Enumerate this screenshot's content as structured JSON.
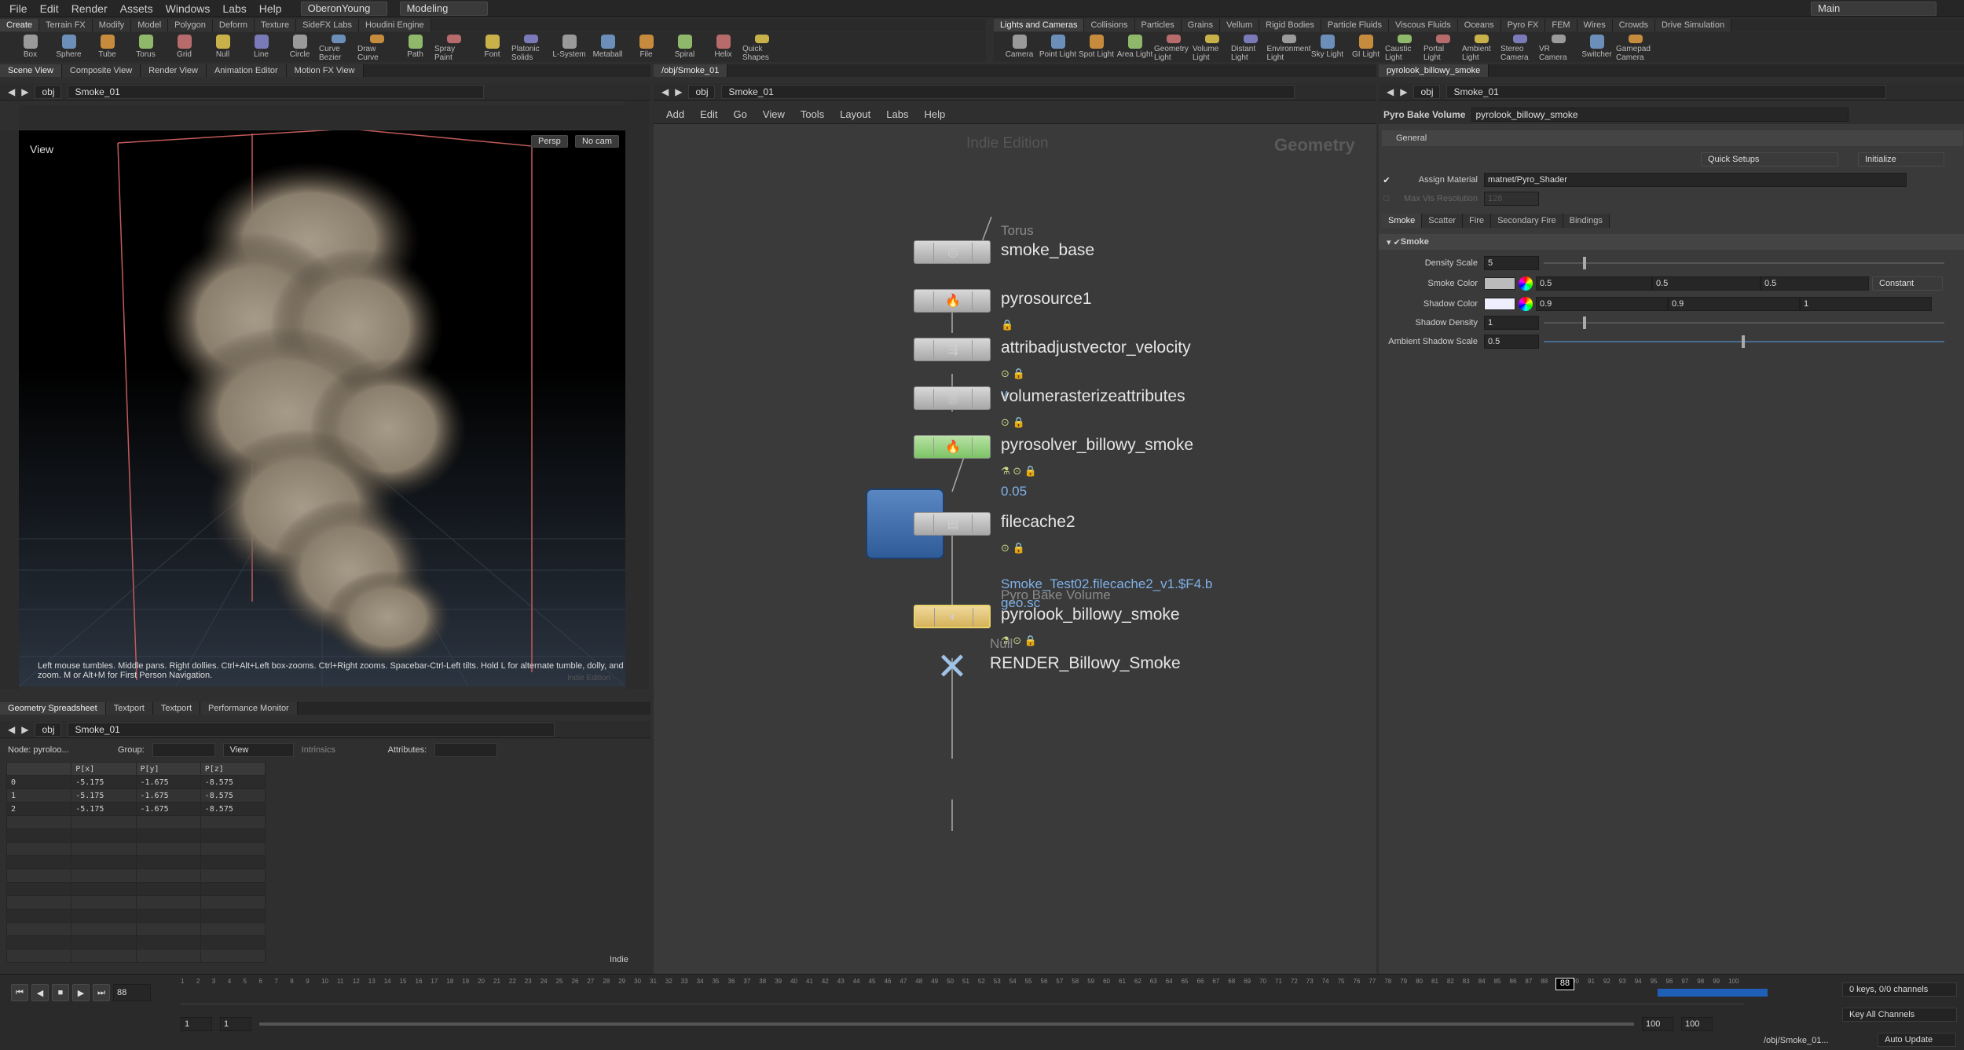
{
  "menubar": {
    "items": [
      "File",
      "Edit",
      "Render",
      "Assets",
      "Windows",
      "Labs",
      "Help"
    ],
    "user": "OberonYoung",
    "desktop": "Modeling",
    "main": "Main"
  },
  "shelf_left": {
    "tabs": [
      "Create",
      "Terrain FX",
      "Modify",
      "Model",
      "Polygon",
      "Deform",
      "Texture",
      "SideFX Labs",
      "Houdini Engine"
    ],
    "tools": [
      "Box",
      "Sphere",
      "Tube",
      "Torus",
      "Grid",
      "Null",
      "Line",
      "Circle",
      "Curve Bezier",
      "Draw Curve",
      "Path",
      "Spray Paint",
      "Font",
      "Platonic Solids",
      "L-System",
      "Metaball",
      "File",
      "Spiral",
      "Helix",
      "Quick Shapes"
    ]
  },
  "shelf_right": {
    "tabs": [
      "Lights and Cameras",
      "Collisions",
      "Particles",
      "Grains",
      "Vellum",
      "Rigid Bodies",
      "Particle Fluids",
      "Viscous Fluids",
      "Oceans",
      "Pyro FX",
      "FEM",
      "Wires",
      "Crowds",
      "Drive Simulation"
    ],
    "tools": [
      "Camera",
      "Point Light",
      "Spot Light",
      "Area Light",
      "Geometry Light",
      "Volume Light",
      "Distant Light",
      "Environment Light",
      "Sky Light",
      "GI Light",
      "Caustic Light",
      "Portal Light",
      "Ambient Light",
      "Stereo Camera",
      "VR Camera",
      "Switcher",
      "Gamepad Camera"
    ]
  },
  "viewer": {
    "tabs": [
      "Scene View",
      "Composite View",
      "Render View",
      "Animation Editor",
      "Motion FX View"
    ],
    "path_root": "obj",
    "path_node": "Smoke_01",
    "view_label": "View",
    "persp": "Persp",
    "cam": "No cam",
    "hint": "Left mouse tumbles. Middle pans. Right dollies. Ctrl+Alt+Left box-zooms. Ctrl+Right zooms. Spacebar-Ctrl-Left tilts. Hold L for alternate tumble, dolly, and zoom. M or Alt+M for First Person Navigation.",
    "watermark": "Indie Edition"
  },
  "network": {
    "tab": "/obj/Smoke_01",
    "path_root": "obj",
    "path_node": "Smoke_01",
    "menu": [
      "Add",
      "Edit",
      "Go",
      "View",
      "Tools",
      "Layout",
      "Labs",
      "Help"
    ],
    "edition": "Indie Edition",
    "context": "Geometry",
    "nodes": [
      {
        "type": "Torus",
        "name": "smoke_base"
      },
      {
        "name": "pyrosource1"
      },
      {
        "name": "attribadjustvector_velocity",
        "sub": "v"
      },
      {
        "name": "volumerasterizeattributes"
      },
      {
        "name": "pyrosolver_billowy_smoke",
        "sub": "0.05"
      },
      {
        "name": "filecache2",
        "sub": "Smoke_Test02.filecache2_v1.$F4.b",
        "sub2": "geo.sc"
      },
      {
        "type": "Pyro Bake Volume",
        "name": "pyrolook_billowy_smoke"
      },
      {
        "type": "Null",
        "name": "RENDER_Billowy_Smoke"
      }
    ]
  },
  "params": {
    "tab": "pyrolook_billowy_smoke",
    "path_root": "obj",
    "path_node": "Smoke_01",
    "node_type": "Pyro Bake Volume",
    "node_name": "pyrolook_billowy_smoke",
    "general": "General",
    "quick_setups": "Quick Setups",
    "initialize": "Initialize",
    "assign_material_label": "Assign Material",
    "assign_material": "matnet/Pyro_Shader",
    "max_vis_label": "Max Vis Resolution",
    "max_vis": "128",
    "tabs": [
      "Smoke",
      "Scatter",
      "Fire",
      "Secondary Fire",
      "Bindings"
    ],
    "section": "Smoke",
    "density_scale_label": "Density Scale",
    "density_scale": "5",
    "smoke_color_label": "Smoke Color",
    "smoke_color": [
      "0.5",
      "0.5",
      "0.5"
    ],
    "smoke_color_mode": "Constant",
    "shadow_color_label": "Shadow Color",
    "shadow_color": [
      "0.9",
      "0.9",
      "1"
    ],
    "shadow_density_label": "Shadow Density",
    "shadow_density": "1",
    "ambient_shadow_label": "Ambient Shadow Scale",
    "ambient_shadow": "0.5"
  },
  "spreadsheet": {
    "tabs": [
      "Geometry Spreadsheet",
      "Textport",
      "Textport",
      "Performance Monitor"
    ],
    "path_root": "obj",
    "path_node": "Smoke_01",
    "node": "Node: pyroloo...",
    "group_label": "Group:",
    "view": "View",
    "intrinsics": "Intrinsics",
    "attributes": "Attributes:",
    "columns": [
      "",
      "P[x]",
      "P[y]",
      "P[z]"
    ],
    "rows": [
      [
        "0",
        "-5.175",
        "-1.675",
        "-8.575"
      ],
      [
        "1",
        "-5.175",
        "-1.675",
        "-8.575"
      ],
      [
        "2",
        "-5.175",
        "-1.675",
        "-8.575"
      ]
    ],
    "indie": "Indie"
  },
  "timeline": {
    "frame": "88",
    "start": "1",
    "start2": "1",
    "end": "100",
    "end2": "100",
    "ticks": [
      "1",
      "2",
      "3",
      "4",
      "5",
      "6",
      "7",
      "8",
      "9",
      "10",
      "11",
      "12",
      "13",
      "14",
      "15",
      "16",
      "17",
      "18",
      "19",
      "20",
      "21",
      "22",
      "23",
      "24",
      "25",
      "26",
      "27",
      "28",
      "29",
      "30",
      "31",
      "32",
      "33",
      "34",
      "35",
      "36",
      "37",
      "38",
      "39",
      "40",
      "41",
      "42",
      "43",
      "44",
      "45",
      "46",
      "47",
      "48",
      "49",
      "50",
      "51",
      "52",
      "53",
      "54",
      "55",
      "56",
      "57",
      "58",
      "59",
      "60",
      "61",
      "62",
      "63",
      "64",
      "65",
      "66",
      "67",
      "68",
      "69",
      "70",
      "71",
      "72",
      "73",
      "74",
      "75",
      "76",
      "77",
      "78",
      "79",
      "80",
      "81",
      "82",
      "83",
      "84",
      "85",
      "86",
      "87",
      "88",
      "89",
      "90",
      "91",
      "92",
      "93",
      "94",
      "95",
      "96",
      "97",
      "98",
      "99",
      "100"
    ],
    "keys": "0 keys, 0/0 channels",
    "key_all": "Key All Channels",
    "status_path": "/obj/Smoke_01...",
    "auto_update": "Auto Update"
  }
}
